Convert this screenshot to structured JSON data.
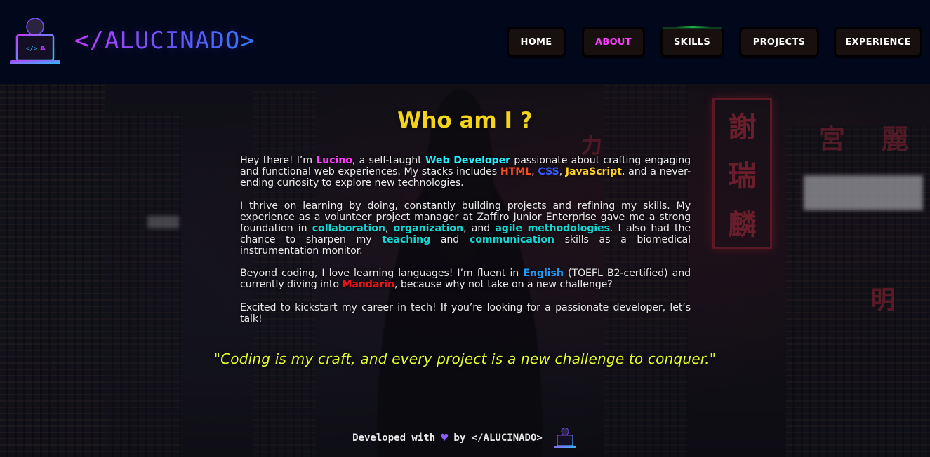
{
  "header": {
    "brand": "</ALUCINADO>",
    "nav": [
      {
        "label": "HOME",
        "active": false
      },
      {
        "label": "ABOUT",
        "active": true
      },
      {
        "label": "SKILLS",
        "active": false
      },
      {
        "label": "PROJECTS",
        "active": false
      },
      {
        "label": "EXPERIENCE",
        "active": false
      }
    ]
  },
  "about": {
    "title": "Who am I ?",
    "p1": {
      "t1": "Hey there! I’m ",
      "name": "Lucino",
      "t2": ", a self-taught ",
      "role": "Web Developer",
      "t3": " passionate about crafting engaging and functional web experiences. My stacks includes ",
      "html": "HTML",
      "sep1": ", ",
      "css": "CSS",
      "sep2": ", ",
      "js": "JavaScript",
      "t4": ", and a never-ending curiosity to explore new technologies."
    },
    "p2": {
      "t1": "I thrive on learning by doing, constantly building projects and refining my skills. My experience as a volunteer project manager at Zaffiro Junior Enterprise gave me a strong foundation in ",
      "k1": "collaboration",
      "sep1": ", ",
      "k2": "organization",
      "t2": ", and ",
      "k3": "agile methodologies",
      "t3": ". I also had the chance to sharpen my ",
      "k4": "teaching",
      "t4": " and ",
      "k5": "communication",
      "t5": " skills as a biomedical instrumentation monitor."
    },
    "p3": {
      "t1": "Beyond coding, I love learning languages! I’m fluent in ",
      "lang1": "English",
      "t2": " (TOEFL B2-certified) and currently diving into ",
      "lang2": "Mandarin",
      "t3": ", because why not take on a new challenge?"
    },
    "p4": "Excited to kickstart my career in tech! If you’re looking for a passionate developer, let’s talk!",
    "quote": "\"Coding is my craft, and every project is a new challenge to conquer.\""
  },
  "footer": {
    "before": "Developed with",
    "heart": "♥",
    "after": "by </ALUCINADO>"
  },
  "colors": {
    "header_bg": "#02081c",
    "title": "#f2d41a",
    "active_nav": "#ff3cff",
    "quote": "#e5ff2a"
  },
  "icons": [
    "hacker-laptop-logo-icon",
    "heart-icon"
  ]
}
